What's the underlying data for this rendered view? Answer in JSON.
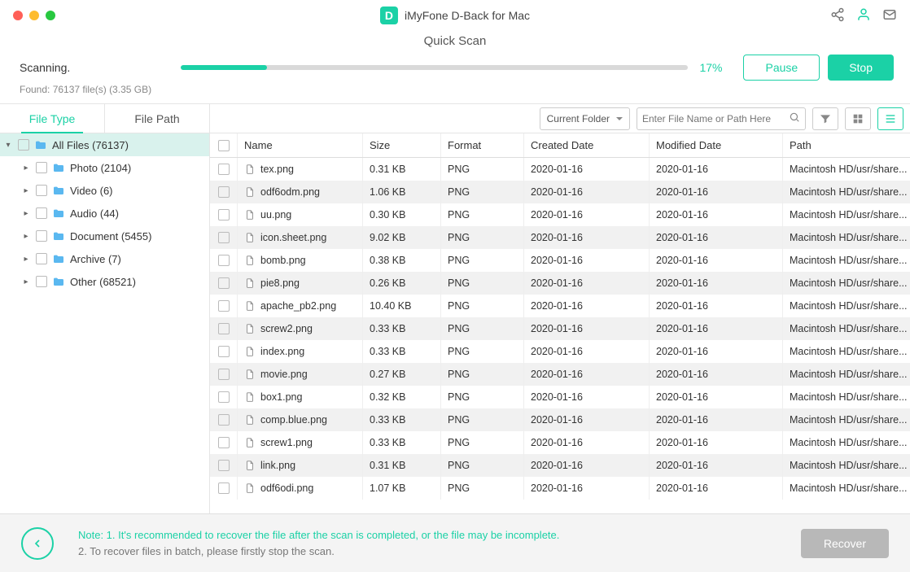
{
  "app": {
    "title": "iMyFone D-Back for Mac",
    "logoLetter": "D"
  },
  "header": {
    "scanMode": "Quick Scan",
    "status": "Scanning.",
    "found": "Found: 76137 file(s) (3.35 GB)",
    "progressPct": 17,
    "progressLabel": "17%",
    "pause": "Pause",
    "stop": "Stop"
  },
  "tabs": {
    "fileType": "File Type",
    "filePath": "File Path"
  },
  "tree": [
    {
      "label": "All Files (76137)",
      "depth": 0,
      "expanded": true,
      "root": true
    },
    {
      "label": "Photo (2104)",
      "depth": 1,
      "expanded": false
    },
    {
      "label": "Video (6)",
      "depth": 1,
      "expanded": false
    },
    {
      "label": "Audio (44)",
      "depth": 1,
      "expanded": false
    },
    {
      "label": "Document (5455)",
      "depth": 1,
      "expanded": false
    },
    {
      "label": "Archive (7)",
      "depth": 1,
      "expanded": false
    },
    {
      "label": "Other (68521)",
      "depth": 1,
      "expanded": false
    }
  ],
  "toolbar": {
    "folderSel": "Current Folder",
    "searchPlaceholder": "Enter File Name or Path Here"
  },
  "columns": {
    "name": "Name",
    "size": "Size",
    "format": "Format",
    "created": "Created Date",
    "modified": "Modified Date",
    "path": "Path"
  },
  "rows": [
    {
      "name": "tex.png",
      "size": "0.31 KB",
      "fmt": "PNG",
      "created": "2020-01-16",
      "modified": "2020-01-16",
      "path": "Macintosh HD/usr/share..."
    },
    {
      "name": "odf6odm.png",
      "size": "1.06 KB",
      "fmt": "PNG",
      "created": "2020-01-16",
      "modified": "2020-01-16",
      "path": "Macintosh HD/usr/share..."
    },
    {
      "name": "uu.png",
      "size": "0.30 KB",
      "fmt": "PNG",
      "created": "2020-01-16",
      "modified": "2020-01-16",
      "path": "Macintosh HD/usr/share..."
    },
    {
      "name": "icon.sheet.png",
      "size": "9.02 KB",
      "fmt": "PNG",
      "created": "2020-01-16",
      "modified": "2020-01-16",
      "path": "Macintosh HD/usr/share..."
    },
    {
      "name": "bomb.png",
      "size": "0.38 KB",
      "fmt": "PNG",
      "created": "2020-01-16",
      "modified": "2020-01-16",
      "path": "Macintosh HD/usr/share..."
    },
    {
      "name": "pie8.png",
      "size": "0.26 KB",
      "fmt": "PNG",
      "created": "2020-01-16",
      "modified": "2020-01-16",
      "path": "Macintosh HD/usr/share..."
    },
    {
      "name": "apache_pb2.png",
      "size": "10.40 KB",
      "fmt": "PNG",
      "created": "2020-01-16",
      "modified": "2020-01-16",
      "path": "Macintosh HD/usr/share..."
    },
    {
      "name": "screw2.png",
      "size": "0.33 KB",
      "fmt": "PNG",
      "created": "2020-01-16",
      "modified": "2020-01-16",
      "path": "Macintosh HD/usr/share..."
    },
    {
      "name": "index.png",
      "size": "0.33 KB",
      "fmt": "PNG",
      "created": "2020-01-16",
      "modified": "2020-01-16",
      "path": "Macintosh HD/usr/share..."
    },
    {
      "name": "movie.png",
      "size": "0.27 KB",
      "fmt": "PNG",
      "created": "2020-01-16",
      "modified": "2020-01-16",
      "path": "Macintosh HD/usr/share..."
    },
    {
      "name": "box1.png",
      "size": "0.32 KB",
      "fmt": "PNG",
      "created": "2020-01-16",
      "modified": "2020-01-16",
      "path": "Macintosh HD/usr/share..."
    },
    {
      "name": "comp.blue.png",
      "size": "0.33 KB",
      "fmt": "PNG",
      "created": "2020-01-16",
      "modified": "2020-01-16",
      "path": "Macintosh HD/usr/share..."
    },
    {
      "name": "screw1.png",
      "size": "0.33 KB",
      "fmt": "PNG",
      "created": "2020-01-16",
      "modified": "2020-01-16",
      "path": "Macintosh HD/usr/share..."
    },
    {
      "name": "link.png",
      "size": "0.31 KB",
      "fmt": "PNG",
      "created": "2020-01-16",
      "modified": "2020-01-16",
      "path": "Macintosh HD/usr/share..."
    },
    {
      "name": "odf6odi.png",
      "size": "1.07 KB",
      "fmt": "PNG",
      "created": "2020-01-16",
      "modified": "2020-01-16",
      "path": "Macintosh HD/usr/share..."
    }
  ],
  "footer": {
    "note1": "Note: 1. It's recommended to recover the file after the scan is completed, or the file may be incomplete.",
    "note2": "2. To recover files in batch, please firstly stop the scan.",
    "recover": "Recover"
  }
}
